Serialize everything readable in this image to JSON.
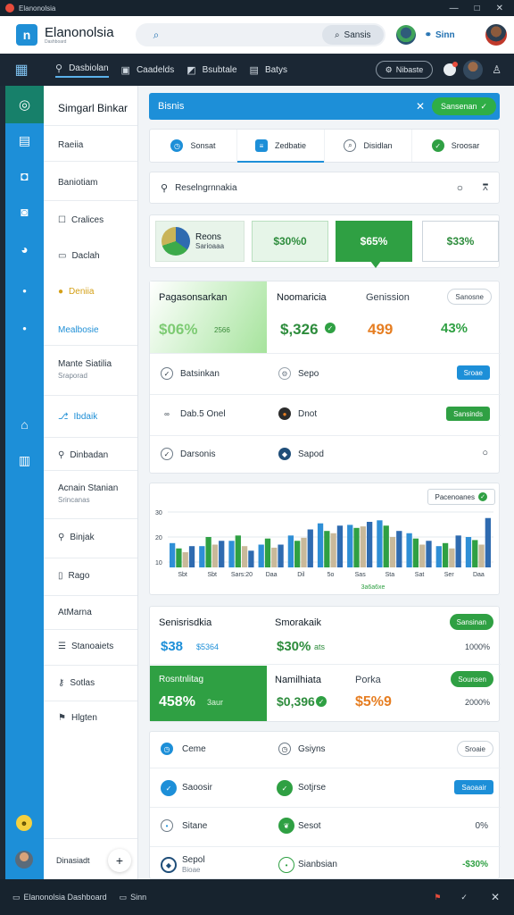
{
  "titlebar": {
    "title": "Elanonolsia",
    "controls": [
      "—",
      "□",
      "✕"
    ]
  },
  "header": {
    "logo_letter": "n",
    "brand": "Elanonolsia",
    "brand_sub": "Dashboard",
    "search_button": "Sansis",
    "pill": "Sinn",
    "accent": "#1d8fd8"
  },
  "navbar": {
    "items": [
      {
        "label": "Dasbiolan",
        "icon": "person-icon"
      },
      {
        "label": "Caadelds",
        "icon": "chat-icon"
      },
      {
        "label": "Bsubtale",
        "icon": "folder-icon"
      },
      {
        "label": "Batys",
        "icon": "document-icon"
      }
    ],
    "button": "Nibaste"
  },
  "sidemenu": {
    "title": "Simgarl Binkar",
    "items": [
      {
        "label": "Raeiia",
        "sub": ""
      },
      {
        "label": "Baniotiam",
        "sub": ""
      },
      {
        "label": "Cralices",
        "sub": ""
      },
      {
        "label": "Daclah",
        "sub": ""
      },
      {
        "label": "Deniia",
        "sub": ""
      },
      {
        "label": "Mealbosie",
        "sub": ""
      },
      {
        "label": "Mante Siatilia",
        "sub": "Sraporad"
      },
      {
        "label": "Ibdaik",
        "sub": ""
      },
      {
        "label": "Dinbadan",
        "sub": ""
      },
      {
        "label": "Acnain Stanian",
        "sub": "Srincanas"
      },
      {
        "label": "Binjak",
        "sub": ""
      },
      {
        "label": "Rago",
        "sub": ""
      },
      {
        "label": "AtMarna",
        "sub": ""
      },
      {
        "label": "Stanoaiets",
        "sub": ""
      },
      {
        "label": "Sotlas",
        "sub": ""
      },
      {
        "label": "Hlgten",
        "sub": ""
      }
    ],
    "footer": "Dinasiadt"
  },
  "main": {
    "banner": {
      "title": "Bisnis",
      "button": "Sansenan"
    },
    "tabs": [
      {
        "label": "Sonsat"
      },
      {
        "label": "Zedbatie"
      },
      {
        "label": "Disidlan"
      },
      {
        "label": "Sroosar"
      }
    ],
    "filter": {
      "label": "Reselngrnnakia"
    },
    "kpis": {
      "pie_title": "Reons",
      "pie_sub": "Sarioaaa",
      "k1": "$30%0",
      "k2": "$65%",
      "k3": "$33%"
    },
    "stats1": {
      "c1": {
        "label": "Pagasonsarkan",
        "value": "$06%",
        "unit": "2566"
      },
      "c2": {
        "label": "Noomaricia",
        "value": "$,326"
      },
      "c3": {
        "label": "Genission",
        "value": "499"
      },
      "c4": {
        "label": "Sanosne",
        "value": "43%"
      },
      "rows": [
        {
          "left": "Batsinkan",
          "mid": "Sepo",
          "action": "Sroae",
          "action_color": "blue"
        },
        {
          "left": "Dab.5 Onel",
          "mid": "Dnot",
          "action": "Sansinds",
          "action_color": "green"
        },
        {
          "left": "Darsonis",
          "mid": "Sapod",
          "action": "",
          "action_color": ""
        }
      ]
    },
    "chart": {
      "pill": "Pacenoanes",
      "footer": "3a6a6xe"
    },
    "stats2": {
      "a1": {
        "label": "Senisrisdkia",
        "value": "$38",
        "sub": "$5364"
      },
      "a2": {
        "label": "Smorakaik",
        "value": "$30%",
        "sub": "ats"
      },
      "a3": {
        "button": "Sansinan",
        "sub": "1000%"
      },
      "b1": {
        "label": "Rosntnlitag",
        "value": "458%",
        "sub": "3aur"
      },
      "b2": {
        "label": "Namilhiata",
        "value": "$0,396"
      },
      "b3": {
        "label": "Porka",
        "value": "$5%9"
      },
      "b4": {
        "button": "Sounsen",
        "sub": "2000%"
      }
    },
    "list": [
      {
        "left": "Ceme",
        "mid": "Gsiyns",
        "right": "Sroaie",
        "right_style": "outline"
      },
      {
        "left": "Saoosir",
        "mid": "Sotjrse",
        "right": "Saoaair",
        "right_style": "blue"
      },
      {
        "left": "Sitane",
        "mid": "Sesot",
        "right": "0%",
        "right_style": "text"
      },
      {
        "left": "Sepol",
        "mid": "Sianbsian",
        "right": "-$30%",
        "right_style": "green"
      }
    ],
    "list_sub": "Bioae"
  },
  "chart_data": {
    "type": "bar",
    "categories": [
      "Sbt",
      "Sbt",
      "Sars:20",
      "Daa",
      "Dil",
      "5o",
      "Sas",
      "Sta",
      "Sat",
      "Ser",
      "Daa"
    ],
    "series": [
      {
        "values": [
          32,
          28,
          35,
          30,
          42,
          58,
          56,
          62,
          45,
          28,
          40
        ]
      },
      {
        "values": [
          25,
          40,
          42,
          38,
          35,
          48,
          52,
          55,
          38,
          32,
          36
        ]
      },
      {
        "values": [
          20,
          30,
          28,
          26,
          39,
          45,
          54,
          40,
          30,
          25,
          30
        ]
      },
      {
        "values": [
          28,
          35,
          22,
          30,
          50,
          55,
          60,
          48,
          35,
          42,
          65
        ]
      }
    ],
    "colors": [
      "#2f8fd6",
      "#2fa043",
      "#c9b99a",
      "#2f6bb0"
    ],
    "y_ticks": [
      "30",
      "20",
      "10"
    ],
    "ylim": [
      0,
      80
    ],
    "grid": true
  }
}
